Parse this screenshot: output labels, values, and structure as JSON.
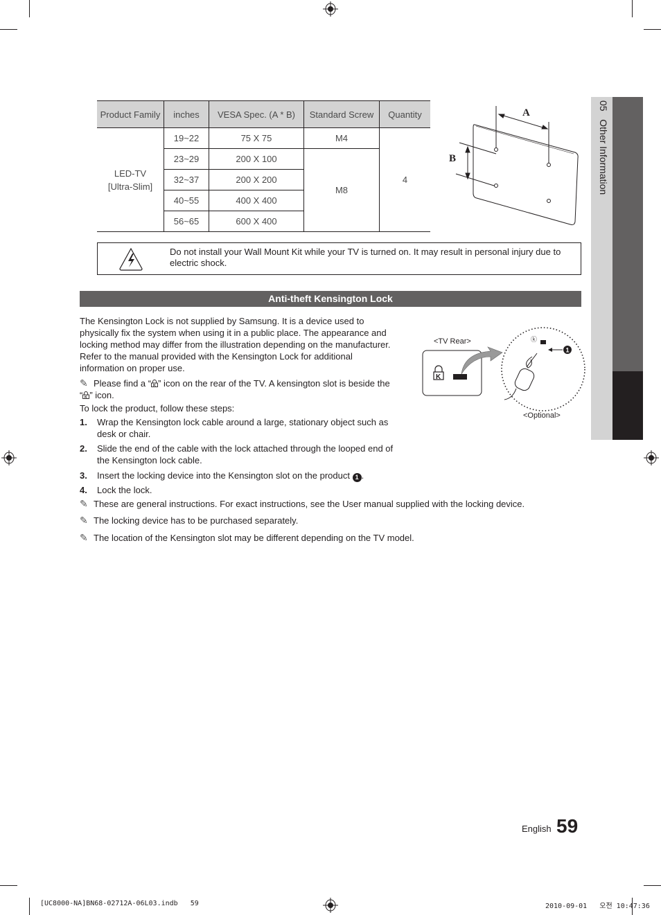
{
  "table": {
    "headers": [
      "Product Family",
      "inches",
      "VESA Spec. (A * B)",
      "Standard Screw",
      "Quantity"
    ],
    "product_family": [
      "LED-TV",
      "[Ultra-Slim]"
    ],
    "rows": [
      {
        "inches": "19~22",
        "vesa": "75 X 75"
      },
      {
        "inches": "23~29",
        "vesa": "200 X 100"
      },
      {
        "inches": "32~37",
        "vesa": "200 X 200"
      },
      {
        "inches": "40~55",
        "vesa": "400 X 400"
      },
      {
        "inches": "56~65",
        "vesa": "600 X 400"
      }
    ],
    "screws": [
      "M4",
      "M8"
    ],
    "quantity": "4"
  },
  "diagram_tv": {
    "label_a": "A",
    "label_b": "B"
  },
  "warning": {
    "icon": "electric-shock-warning-icon",
    "text": "Do not install your Wall Mount Kit while your TV is turned on. It may result in personal injury due to electric shock."
  },
  "section": {
    "title": "Anti-theft Kensington Lock",
    "intro": "The Kensington Lock is not supplied by Samsung. It is a device used to physically fix the system when using it in a public place. The appearance and locking method may differ from the illustration depending on the manufacturer. Refer to the manual provided with the Kensington Lock for additional information on proper use.",
    "note1_a": "Please find a “",
    "note1_b": "” icon on the rear of the TV. A kensington slot is beside the “",
    "note1_c": "” icon.",
    "steps_intro": "To lock the product, follow these steps:",
    "steps": [
      {
        "num": "1.",
        "text": "Wrap the Kensington lock cable around a large, stationary object such as desk or chair."
      },
      {
        "num": "2.",
        "text": "Slide the end of the cable with the lock attached through the looped end of the Kensington lock cable."
      },
      {
        "num": "3.",
        "text": "Insert the locking device into the Kensington slot on the product"
      },
      {
        "num": "4.",
        "text": "Lock the lock."
      }
    ],
    "step3_marker": "1",
    "notes": [
      "These are general instructions. For exact instructions, see the User manual supplied with the locking device.",
      "The locking device has to be purchased separately.",
      "The location of the Kensington slot may be different depending on the TV model."
    ]
  },
  "kensington_diagram": {
    "tv_rear_label": "<TV Rear>",
    "optional_label": "<Optional>",
    "marker": "1",
    "k_letter": "K"
  },
  "side_tab": {
    "chapter": "05",
    "title": "Other Information"
  },
  "footer": {
    "language": "English",
    "page_number": "59",
    "slug_left": "[UC8000-NA]BN68-02712A-06L03.indb   59",
    "slug_right": "2010-09-01   오전 10:47:36"
  }
}
